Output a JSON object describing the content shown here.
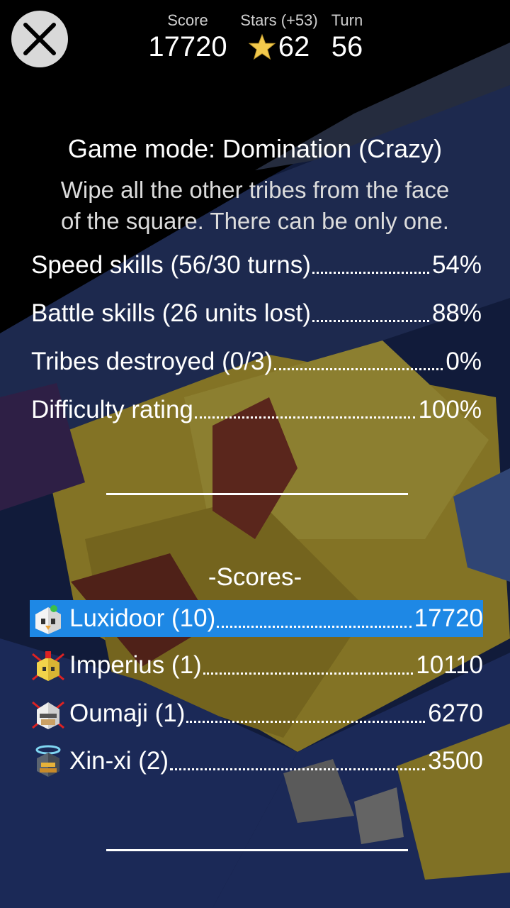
{
  "header": {
    "score_label": "Score",
    "score_value": "17720",
    "stars_label": "Stars (+53)",
    "stars_value": "62",
    "turn_label": "Turn",
    "turn_value": "56",
    "close_icon": "close-icon",
    "star_icon": "star-icon"
  },
  "mode": {
    "title": "Game mode: Domination (Crazy)",
    "description_line1": "Wipe all the other tribes from the face",
    "description_line2": "of the square. There can be only one."
  },
  "skills": [
    {
      "label": "Speed skills (56/30 turns)",
      "value": "54%"
    },
    {
      "label": "Battle skills (26 units lost)",
      "value": "88%"
    },
    {
      "label": "Tribes destroyed (0/3)",
      "value": "0%"
    },
    {
      "label": "Difficulty rating",
      "value": "100%"
    }
  ],
  "scores": {
    "heading": "-Scores-",
    "rows": [
      {
        "label": "Luxidoor (10)",
        "value": "17720",
        "selected": true,
        "avatar": "luxidoor-avatar-icon"
      },
      {
        "label": "Imperius (1)",
        "value": "10110",
        "selected": false,
        "avatar": "imperius-avatar-icon"
      },
      {
        "label": "Oumaji (1)",
        "value": "6270",
        "selected": false,
        "avatar": "oumaji-avatar-icon"
      },
      {
        "label": "Xin-xi (2)",
        "value": "3500",
        "selected": false,
        "avatar": "xinxi-avatar-icon"
      }
    ]
  },
  "colors": {
    "selected_row": "#1e88e5",
    "close_button": "#d9d9d9",
    "star": "#f2c94c"
  }
}
